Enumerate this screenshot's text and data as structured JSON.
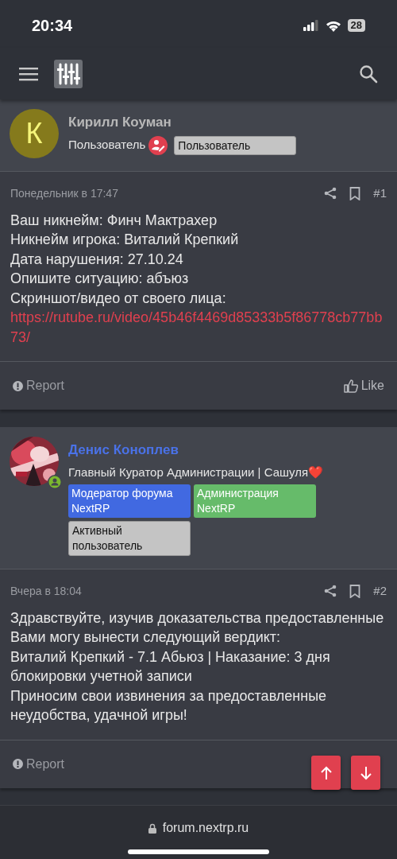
{
  "status_bar": {
    "time": "20:34",
    "battery": "28"
  },
  "posts": [
    {
      "author": {
        "name": "Кирилл Коуман",
        "color": "#b8b8b8",
        "avatar": {
          "kind": "letter",
          "letter": "К",
          "color": "#857a1c"
        },
        "title": "Пользователь",
        "title_badge": true,
        "online": false,
        "banners": [
          {
            "label": "Пользователь",
            "color": "#c4c4c4"
          }
        ]
      },
      "date": "Понедельник в 17:47",
      "number": "#1",
      "lines": [
        {
          "kind": "text",
          "text": "Ваш никнейм: Финч Мактрахер"
        },
        {
          "kind": "text",
          "text": "Никнейм игрока: Виталий Крепкий"
        },
        {
          "kind": "text",
          "text": "Дата нарушения: 27.10.24"
        },
        {
          "kind": "text",
          "text": "Опишите ситуацию: абъюз"
        },
        {
          "kind": "text",
          "text": "Скриншот/видео от своего лица:"
        },
        {
          "kind": "link",
          "text": "https://rutube.ru/video/45b46f4469d85333b5f86778cb77bb73/"
        }
      ],
      "report": "Report",
      "like": "Like"
    },
    {
      "author": {
        "name": "Денис Коноплев",
        "color": "#4a72e8",
        "title": "Главный Куратор Администрации | Сашуля❤️",
        "title_badge": false,
        "online": true,
        "banners": [
          {
            "label": "Модератор форума NextRP",
            "color": "#4169e1"
          },
          {
            "label": "Администрация NextRP",
            "color": "#66bb6a"
          },
          {
            "label": "Активный пользователь",
            "color": "#c4c4c4"
          }
        ]
      },
      "date": "Вчера в 18:04",
      "number": "#2",
      "lines": [
        {
          "kind": "text",
          "text": "Здравствуйте, изучив доказательства предоставленные Вами могу вынести следующий вердикт:"
        },
        {
          "kind": "text",
          "text": "Виталий Крепкий - 7.1 Абьюз | Наказание: 3 дня блокировки учетной записи"
        },
        {
          "kind": "text",
          "text": "Приносим свои извинения за предоставленные неудобства, удачной игры!"
        }
      ],
      "report": "Report"
    }
  ],
  "address_bar": {
    "url": "forum.nextrp.ru"
  }
}
